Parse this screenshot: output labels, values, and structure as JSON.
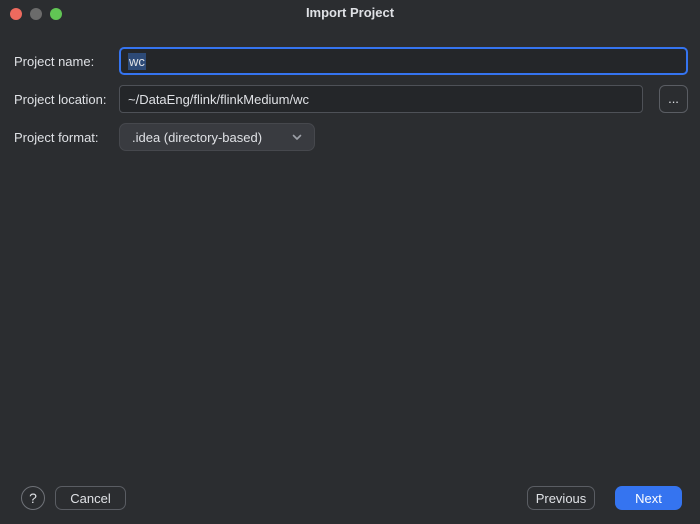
{
  "window": {
    "title": "Import Project"
  },
  "traffic_lights": {
    "close_color": "#ed6a5e",
    "minimize_color": "#6b6b6b",
    "zoom_color": "#61c554"
  },
  "form": {
    "name_row": {
      "label": "Project name:",
      "value": "wc",
      "value_selected": true
    },
    "location_row": {
      "label": "Project location:",
      "value": "~/DataEng/flink/flinkMedium/wc",
      "browse_label": "..."
    },
    "format_row": {
      "label": "Project format:",
      "value": ".idea (directory-based)"
    }
  },
  "footer": {
    "help_label": "?",
    "cancel_label": "Cancel",
    "previous_label": "Previous",
    "next_label": "Next"
  },
  "colors": {
    "window_bg": "#2b2d30",
    "text": "#dfe1e5",
    "accent": "#3574f0",
    "field_border": "#4e5157",
    "button_border": "#5a5d63",
    "selection_bg": "#2d4a77",
    "combo_bg": "#393b40"
  }
}
